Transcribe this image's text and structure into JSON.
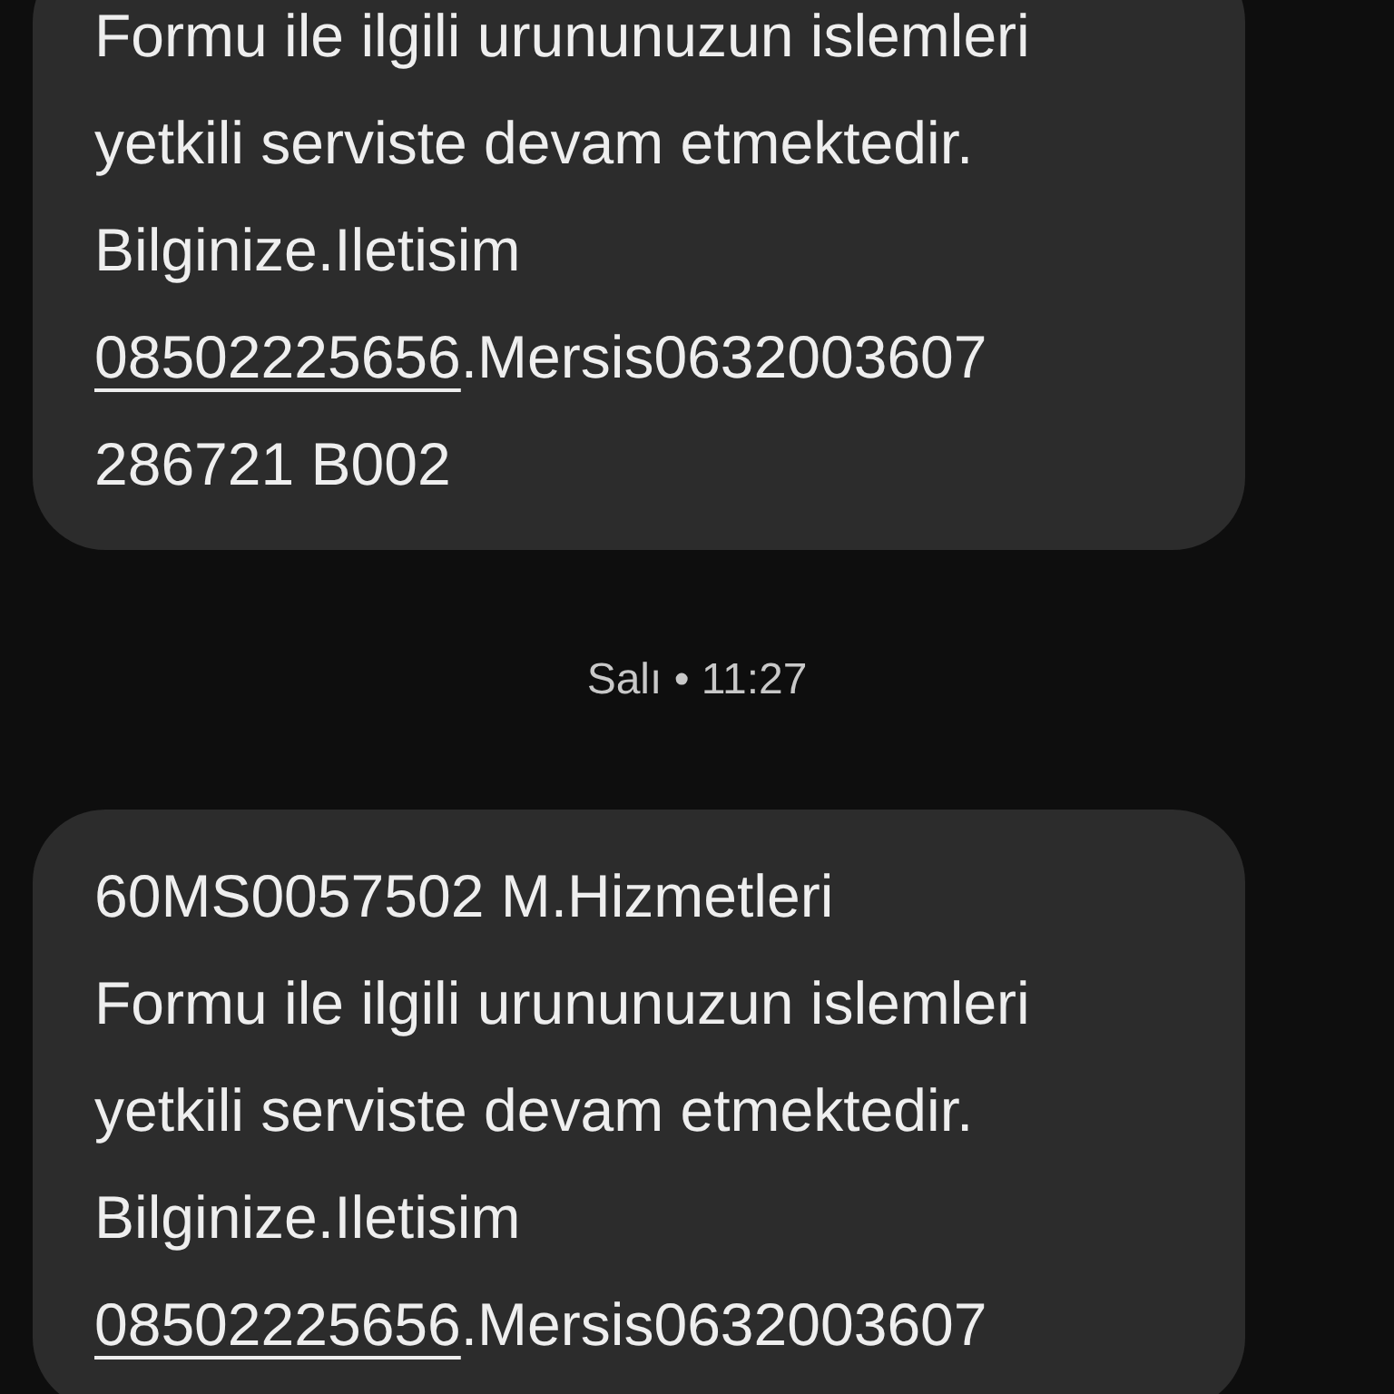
{
  "messages": [
    {
      "lines": [
        [
          {
            "kind": "text",
            "text": "Formu ile ilgili urununuzun islemleri"
          }
        ],
        [
          {
            "kind": "text",
            "text": "yetkili serviste devam etmektedir."
          }
        ],
        [
          {
            "kind": "text",
            "text": "Bilginize.Iletisim"
          }
        ],
        [
          {
            "kind": "link",
            "text": "08502225656"
          },
          {
            "kind": "text",
            "text": ".Mersis0632003607"
          }
        ],
        [
          {
            "kind": "text",
            "text": "286721 B002"
          }
        ]
      ]
    },
    {
      "kind": "timestamp",
      "text": "Salı • 11:27"
    },
    {
      "lines": [
        [
          {
            "kind": "text",
            "text": "60MS0057502 M.Hizmetleri"
          }
        ],
        [
          {
            "kind": "text",
            "text": "Formu ile ilgili urununuzun islemleri"
          }
        ],
        [
          {
            "kind": "text",
            "text": "yetkili serviste devam etmektedir."
          }
        ],
        [
          {
            "kind": "text",
            "text": "Bilginize.Iletisim"
          }
        ],
        [
          {
            "kind": "link",
            "text": "08502225656"
          },
          {
            "kind": "text",
            "text": ".Mersis0632003607"
          }
        ]
      ]
    }
  ]
}
